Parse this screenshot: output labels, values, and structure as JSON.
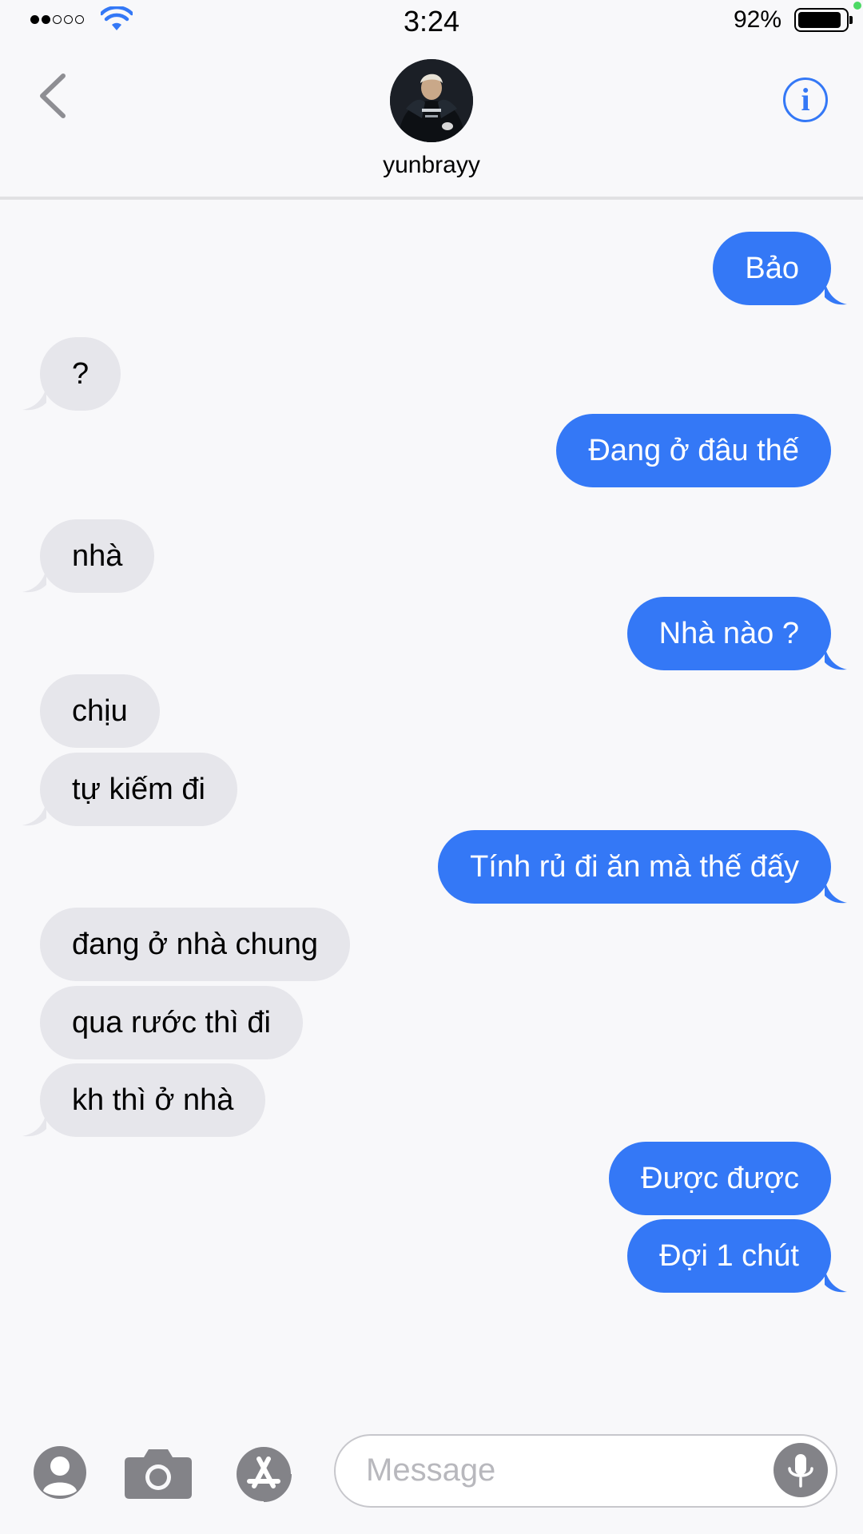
{
  "status_bar": {
    "time": "3:24",
    "battery_percent": "92%",
    "signal_bars_filled": 2,
    "signal_bars_total": 5
  },
  "header": {
    "contact_name": "yunbrayy",
    "back_icon": "chevron-left-icon",
    "info_icon": "info-icon",
    "info_glyph": "i"
  },
  "messages": [
    {
      "from": "me",
      "text": "Bảo"
    },
    {
      "from": "them",
      "text": "?"
    },
    {
      "from": "me",
      "text": "Đang ở đâu thế"
    },
    {
      "from": "them",
      "text": "nhà"
    },
    {
      "from": "me",
      "text": "Nhà nào ?"
    },
    {
      "from": "them",
      "text": "chịu"
    },
    {
      "from": "them",
      "text": "tự kiếm đi"
    },
    {
      "from": "me",
      "text": "Tính rủ đi ăn mà thế đấy"
    },
    {
      "from": "them",
      "text": "đang ở nhà chung"
    },
    {
      "from": "them",
      "text": "qua rước thì đi"
    },
    {
      "from": "them",
      "text": "kh thì ở nhà"
    },
    {
      "from": "me",
      "text": "Được được"
    },
    {
      "from": "me",
      "text": "Đợi 1 chút"
    }
  ],
  "input_bar": {
    "placeholder": "Message",
    "icons": [
      "memoji-icon",
      "camera-icon",
      "app-store-icon",
      "microphone-icon"
    ]
  },
  "colors": {
    "sent_bubble": "#3478f6",
    "received_bubble": "#e6e6eb",
    "accent": "#3478f6"
  }
}
